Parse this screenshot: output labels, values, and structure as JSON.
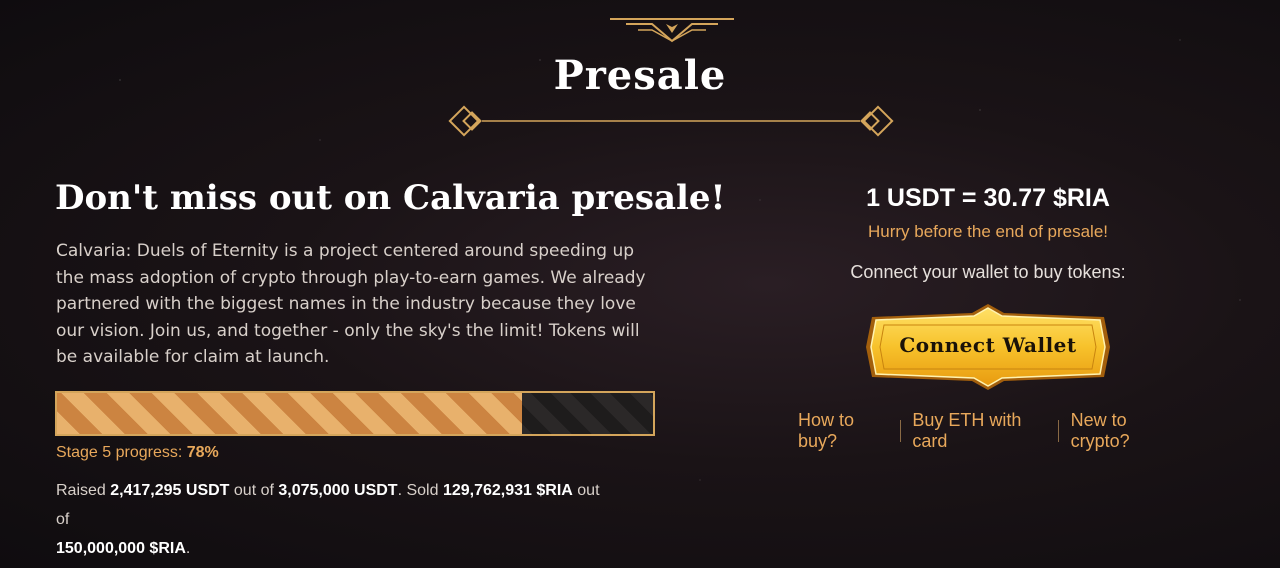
{
  "section": {
    "title": "Presale"
  },
  "presale": {
    "headline": "Don't miss out on Calvaria presale!",
    "description": "Calvaria: Duels of Eternity is a project centered around speeding up the mass adoption of crypto through play-to-earn games. We already partnered with the biggest names in the industry because they love our vision. Join us, and together - only the sky's the limit! Tokens will be available for claim at launch.",
    "progress": {
      "stage_label": "Stage 5 progress:",
      "percent_text": "78%",
      "percent_value": 78
    },
    "raised": {
      "prefix": "Raised",
      "raised_amount": "2,417,295 USDT",
      "out_of_1": "out of",
      "target_amount": "3,075,000 USDT",
      "sold_text": ". Sold",
      "sold_amount": "129,762,931 $RIA",
      "out_of_2": "out of",
      "total_amount": "150,000,000 $RIA",
      "end": "."
    }
  },
  "purchase": {
    "rate": "1 USDT = 30.77 $RIA",
    "hurry": "Hurry before the end of presale!",
    "connect_prompt": "Connect your wallet to buy tokens:",
    "connect_button": "Connect Wallet",
    "links": [
      "How to buy?",
      "Buy ETH with card",
      "New to crypto?"
    ]
  },
  "colors": {
    "accent": "#e8a85b",
    "gold": "#d4a55b",
    "button_yellow": "#f7c22b",
    "background": "#1a1316"
  }
}
